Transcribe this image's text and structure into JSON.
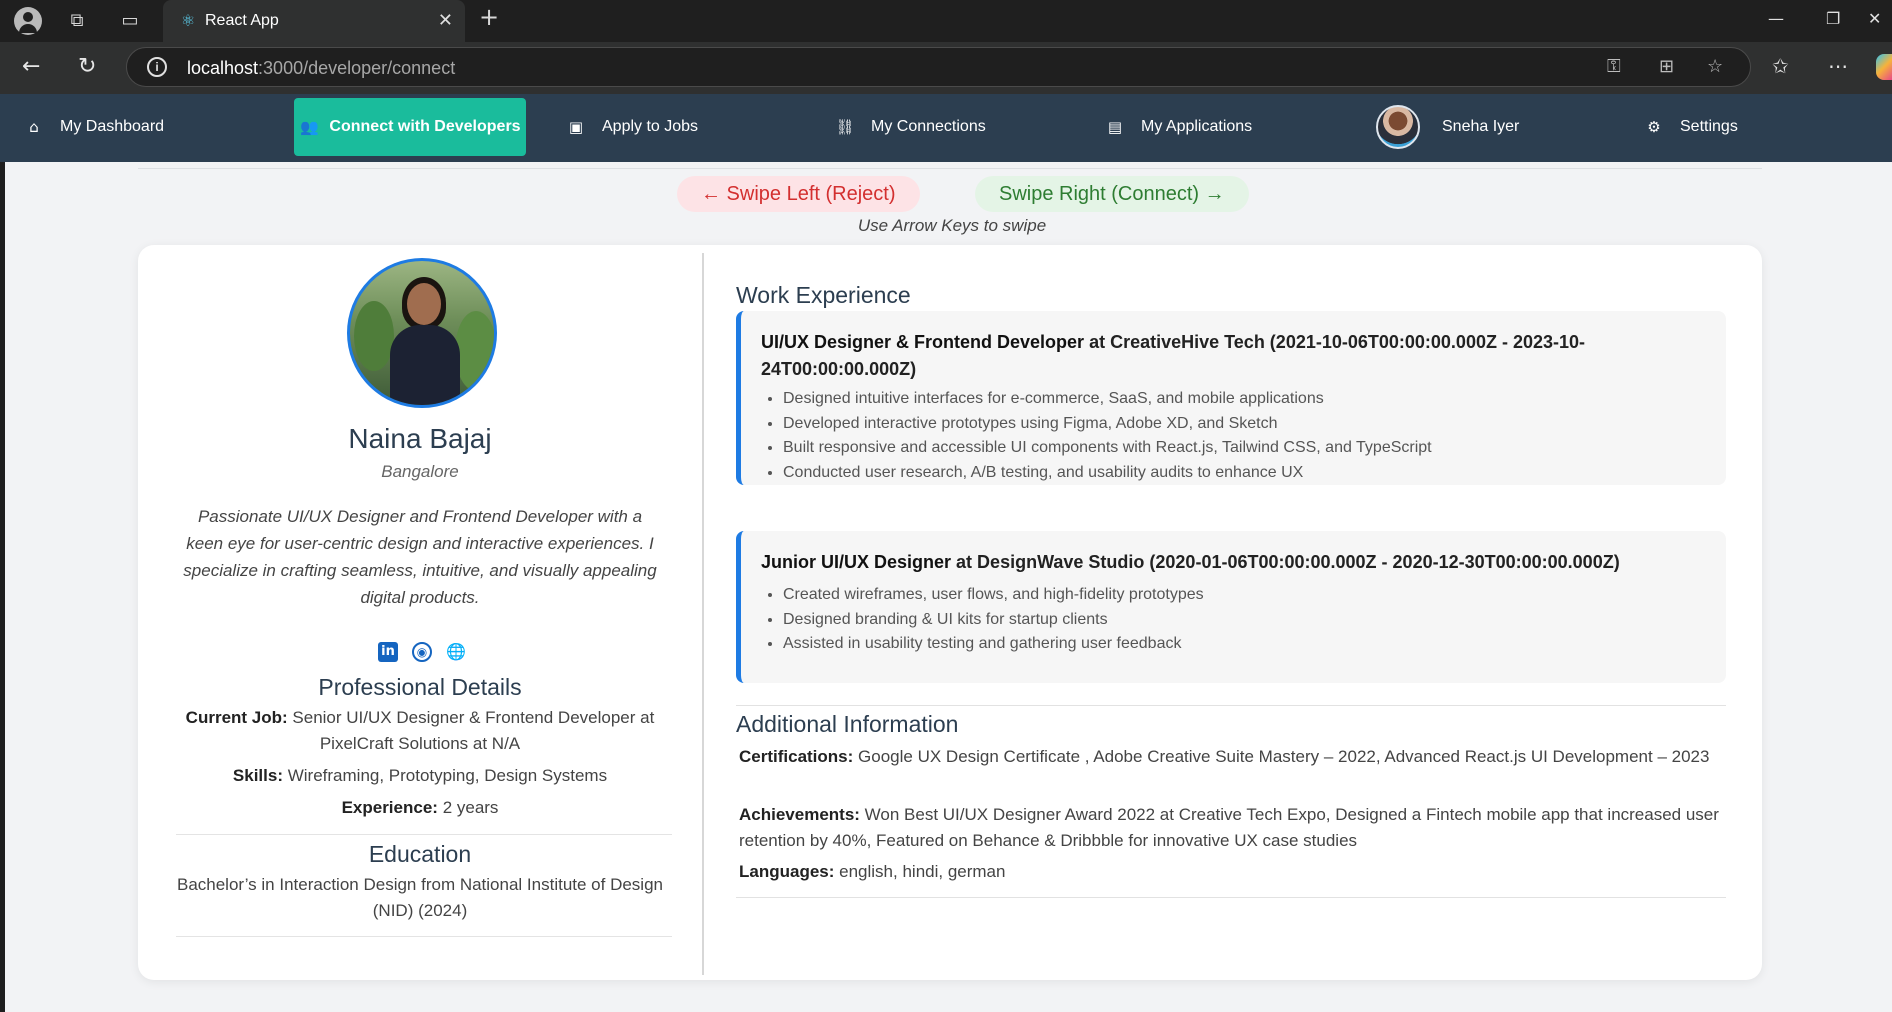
{
  "browser": {
    "tab_title": "React App",
    "url_host": "localhost",
    "url_path": ":3000/developer/connect"
  },
  "nav": {
    "items": [
      {
        "label": "My Dashboard",
        "icon": "home-icon"
      },
      {
        "label": "Connect with Developers",
        "icon": "users-icon"
      },
      {
        "label": "Apply to Jobs",
        "icon": "briefcase-icon"
      },
      {
        "label": "My Connections",
        "icon": "link-icon"
      },
      {
        "label": "My Applications",
        "icon": "file-icon"
      },
      {
        "label": "Sneha Iyer",
        "icon": "avatar"
      },
      {
        "label": "Settings",
        "icon": "gear-icon"
      }
    ],
    "active": "Connect with Developers",
    "colors": {
      "bar": "#2c3e50",
      "active": "#1abc9c"
    }
  },
  "swipe": {
    "left_label": "← Swipe Left (Reject)",
    "right_label": "Swipe Right (Connect) →",
    "hint": "Use Arrow Keys to swipe"
  },
  "profile": {
    "name": "Naina Bajaj",
    "location": "Bangalore",
    "bio": "Passionate UI/UX Designer and Frontend Developer with a keen eye for user-centric design and interactive experiences. I specialize in crafting seamless, intuitive, and visually appealing digital products.",
    "social": [
      "linkedin-icon",
      "github-icon",
      "globe-icon"
    ],
    "professional_title": "Professional Details",
    "current_job_label": "Current Job:",
    "current_job": "Senior UI/UX Designer & Frontend Developer at PixelCraft Solutions at N/A",
    "skills_label": "Skills:",
    "skills": "Wireframing, Prototyping, Design Systems",
    "experience_label": "Experience:",
    "experience": "2 years",
    "education_title": "Education",
    "education": "Bachelor’s in Interaction Design from National Institute of Design (NID) (2024)"
  },
  "work": {
    "title": "Work Experience",
    "jobs": [
      {
        "role": "UI/UX Designer & Frontend Developer",
        "rest": " at CreativeHive Tech (2021-10-06T00:00:00.000Z - 2023-10-24T00:00:00.000Z)",
        "bullets": [
          "Designed intuitive interfaces for e-commerce, SaaS, and mobile applications",
          "Developed interactive prototypes using Figma, Adobe XD, and Sketch",
          "Built responsive and accessible UI components with React.js, Tailwind CSS, and TypeScript",
          "Conducted user research, A/B testing, and usability audits to enhance UX"
        ]
      },
      {
        "role": "Junior UI/UX Designer",
        "rest": " at DesignWave Studio (2020-01-06T00:00:00.000Z - 2020-12-30T00:00:00.000Z)",
        "bullets": [
          "Created wireframes, user flows, and high-fidelity prototypes",
          "Designed branding & UI kits for startup clients",
          "Assisted in usability testing and gathering user feedback"
        ]
      }
    ]
  },
  "additional": {
    "title": "Additional Information",
    "certifications_label": "Certifications:",
    "certifications": "Google UX Design Certificate , Adobe Creative Suite Mastery – 2022, Advanced React.js UI Development – 2023",
    "achievements_label": "Achievements:",
    "achievements": "Won Best UI/UX Designer Award 2022 at Creative Tech Expo, Designed a Fintech mobile app that increased user retention by 40%, Featured on Behance & Dribbble for innovative UX case studies",
    "languages_label": "Languages:",
    "languages": "english, hindi, german"
  }
}
